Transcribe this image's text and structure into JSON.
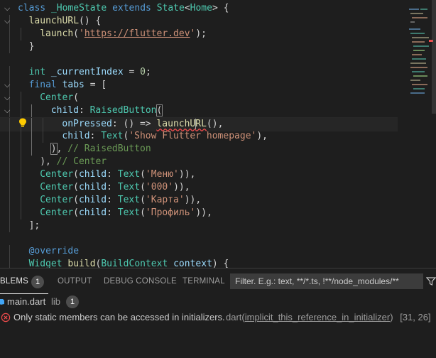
{
  "editor": {
    "lines": [
      {
        "fold": "▾",
        "tokens": [
          [
            "kw",
            "class "
          ],
          [
            "cls",
            "_HomeState "
          ],
          [
            "kw",
            "extends "
          ],
          [
            "cls",
            "State"
          ],
          [
            "pun",
            "<"
          ],
          [
            "cls",
            "Home"
          ],
          [
            "pun",
            "> {"
          ]
        ]
      },
      {
        "fold": "▾",
        "tokens": [
          [
            "fn",
            "launchURL"
          ],
          [
            "pun",
            "() {"
          ]
        ]
      },
      {
        "fold": "",
        "tokens": [
          [
            "fn",
            "launch"
          ],
          [
            "pun",
            "("
          ],
          [
            "str",
            "'"
          ],
          [
            "str link",
            "https://flutter.dev"
          ],
          [
            "str",
            "'"
          ],
          [
            "pun",
            ");"
          ]
        ]
      },
      {
        "fold": "",
        "tokens": [
          [
            "pun",
            "}"
          ]
        ]
      },
      {
        "fold": "",
        "tokens": []
      },
      {
        "fold": "",
        "tokens": [
          [
            "cls",
            "int "
          ],
          [
            "var",
            "_currentIndex "
          ],
          [
            "pun",
            "= "
          ],
          [
            "num",
            "0"
          ],
          [
            "pun",
            ";"
          ]
        ]
      },
      {
        "fold": "▾",
        "tokens": [
          [
            "kw",
            "final "
          ],
          [
            "var",
            "tabs "
          ],
          [
            "pun",
            "= ["
          ]
        ]
      },
      {
        "fold": "▾",
        "tokens": [
          [
            "cls",
            "Center"
          ],
          [
            "pun",
            "("
          ]
        ]
      },
      {
        "fold": "▾",
        "tokens": [
          [
            "var",
            "child"
          ],
          [
            "pun",
            ": "
          ],
          [
            "cls",
            "RaisedButton"
          ],
          [
            "pun bracket-box",
            "("
          ]
        ]
      },
      {
        "fold": "",
        "tokens": [
          [
            "var",
            "onPressed"
          ],
          [
            "pun",
            ": () => "
          ],
          [
            "fn err",
            "launchU"
          ],
          [
            "cursor",
            ""
          ],
          [
            "fn err",
            "RL"
          ],
          [
            "pun",
            "(),"
          ]
        ]
      },
      {
        "fold": "",
        "tokens": [
          [
            "var",
            "child"
          ],
          [
            "pun",
            ": "
          ],
          [
            "cls",
            "Text"
          ],
          [
            "pun",
            "("
          ],
          [
            "str",
            "'Show Flutter homepage'"
          ],
          [
            "pun",
            "),"
          ]
        ]
      },
      {
        "fold": "",
        "tokens": [
          [
            "pun bracket-box",
            ")"
          ],
          [
            "pun",
            ", "
          ],
          [
            "cmt",
            "// RaisedButton"
          ]
        ]
      },
      {
        "fold": "",
        "tokens": [
          [
            "pun",
            "), "
          ],
          [
            "cmt",
            "// Center"
          ]
        ]
      },
      {
        "fold": "",
        "tokens": [
          [
            "cls",
            "Center"
          ],
          [
            "pun",
            "("
          ],
          [
            "var",
            "child"
          ],
          [
            "pun",
            ": "
          ],
          [
            "cls",
            "Text"
          ],
          [
            "pun",
            "("
          ],
          [
            "str",
            "'Меню'"
          ],
          [
            "pun",
            ")),"
          ]
        ]
      },
      {
        "fold": "",
        "tokens": [
          [
            "cls",
            "Center"
          ],
          [
            "pun",
            "("
          ],
          [
            "var",
            "child"
          ],
          [
            "pun",
            ": "
          ],
          [
            "cls",
            "Text"
          ],
          [
            "pun",
            "("
          ],
          [
            "str",
            "'000'"
          ],
          [
            "pun",
            ")),"
          ]
        ]
      },
      {
        "fold": "",
        "tokens": [
          [
            "cls",
            "Center"
          ],
          [
            "pun",
            "("
          ],
          [
            "var",
            "child"
          ],
          [
            "pun",
            ": "
          ],
          [
            "cls",
            "Text"
          ],
          [
            "pun",
            "("
          ],
          [
            "str",
            "'Карта'"
          ],
          [
            "pun",
            ")),"
          ]
        ]
      },
      {
        "fold": "",
        "tokens": [
          [
            "cls",
            "Center"
          ],
          [
            "pun",
            "("
          ],
          [
            "var",
            "child"
          ],
          [
            "pun",
            ": "
          ],
          [
            "cls",
            "Text"
          ],
          [
            "pun",
            "("
          ],
          [
            "str",
            "'Профиль'"
          ],
          [
            "pun",
            ")),"
          ]
        ]
      },
      {
        "fold": "",
        "tokens": [
          [
            "pun",
            "];"
          ]
        ]
      },
      {
        "fold": "",
        "tokens": []
      },
      {
        "fold": "",
        "tokens": [
          [
            "ann",
            "@override"
          ]
        ]
      },
      {
        "fold": "",
        "tokens": [
          [
            "cls",
            "Widget "
          ],
          [
            "fn",
            "build"
          ],
          [
            "pun",
            "("
          ],
          [
            "cls",
            "BuildContext "
          ],
          [
            "var",
            "context"
          ],
          [
            "pun",
            ") {"
          ]
        ]
      }
    ]
  },
  "panel": {
    "tabs": [
      {
        "label": "BLEMS"
      },
      {
        "label": "OUTPUT"
      },
      {
        "label": "DEBUG CONSOLE"
      },
      {
        "label": "TERMINAL"
      }
    ],
    "problems_count": "1",
    "filter_placeholder": "Filter. E.g.: text, **/*.ts, !**/node_modules/**",
    "file": {
      "name": "main.dart",
      "folder": "lib",
      "count": "1"
    },
    "problem": {
      "message": "Only static members can be accessed in initializers.",
      "source": "dart(",
      "code": "implicit_this_reference_in_initializer",
      "source_end": ")",
      "position": "[31, 26]"
    }
  },
  "colors": {
    "background": "#1e1e1e",
    "keyword": "#569cd6",
    "type": "#4ec9b0",
    "function": "#dcdcaa",
    "string": "#ce9178",
    "error": "#f14c4c"
  }
}
